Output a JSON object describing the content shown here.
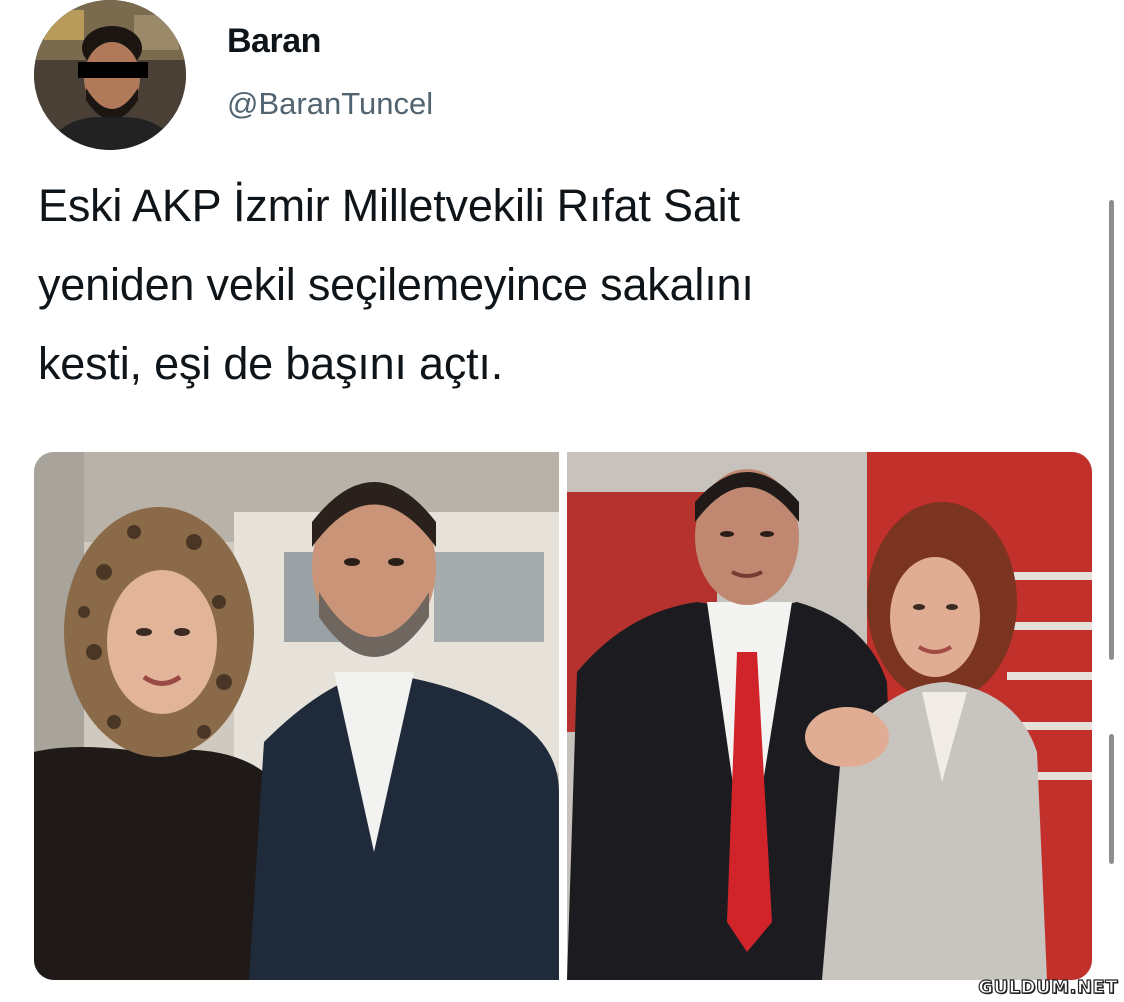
{
  "tweet": {
    "author": {
      "display_name": "Baran",
      "handle": "@BaranTuncel",
      "avatar_icon": "profile-photo"
    },
    "text_lines": [
      "Eski AKP İzmir Milletvekili Rıfat Sait",
      "yeniden vekil seçilemeyince sakalını",
      "kesti, eşi de başını açtı."
    ],
    "media": [
      {
        "icon": "photo-couple-before"
      },
      {
        "icon": "photo-couple-after"
      }
    ]
  },
  "watermark": "GULDUM.NET",
  "colors": {
    "text": "#0f1419",
    "secondary_text": "#536471",
    "background": "#ffffff"
  }
}
